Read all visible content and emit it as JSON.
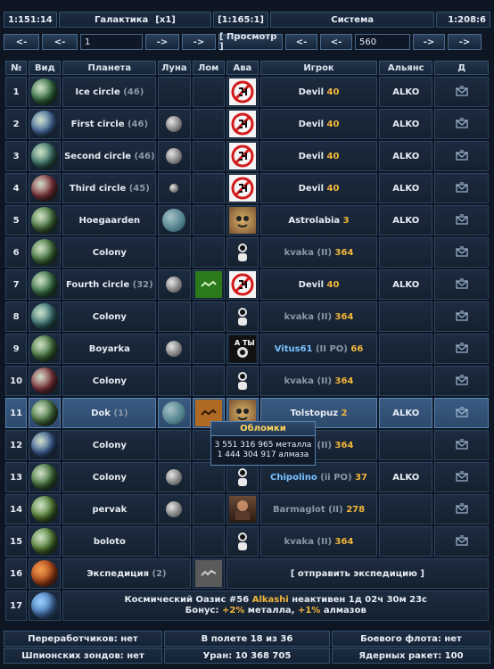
{
  "header": {
    "coords_left": "1:151:14",
    "title": "Галактика",
    "multiplier": "[x1]",
    "coords_mid": "[1:165:1]",
    "system_label": "Система",
    "coords_right": "1:208:6"
  },
  "nav": {
    "galaxy_prev_fast": "<-",
    "galaxy_prev": "<-",
    "galaxy_value": "1",
    "galaxy_next": "->",
    "galaxy_next_fast": "->",
    "view_button": "[ Просмотр ]",
    "system_prev_fast": "<-",
    "system_prev": "<-",
    "system_value": "560",
    "system_next": "->",
    "system_next_fast": "->"
  },
  "columns": [
    "№",
    "Вид",
    "Планета",
    "Луна",
    "Лом",
    "Ава",
    "Игрок",
    "Альянс",
    "Д"
  ],
  "rows": [
    {
      "num": "1",
      "planet": "Ice circle",
      "count": "(46)",
      "planet_color": "#3e7a4a",
      "moon": "",
      "debris": false,
      "ava": "banned",
      "player": "Devil",
      "player_tag": "",
      "level": "40",
      "player_style": "white",
      "alliance": "ALKO"
    },
    {
      "num": "2",
      "planet": "First circle",
      "count": "(46)",
      "planet_color": "#4a6fa8",
      "moon": "normal",
      "debris": false,
      "ava": "banned",
      "player": "Devil",
      "player_tag": "",
      "level": "40",
      "player_style": "white",
      "alliance": "ALKO"
    },
    {
      "num": "3",
      "planet": "Second circle",
      "count": "(46)",
      "planet_color": "#3f7c6e",
      "moon": "normal",
      "debris": false,
      "ava": "banned",
      "player": "Devil",
      "player_tag": "",
      "level": "40",
      "player_style": "white",
      "alliance": "ALKO"
    },
    {
      "num": "4",
      "planet": "Third circle",
      "count": "(45)",
      "planet_color": "#8a3a44",
      "moon": "small",
      "debris": false,
      "ava": "banned",
      "player": "Devil",
      "player_tag": "",
      "level": "40",
      "player_style": "white",
      "alliance": "ALKO"
    },
    {
      "num": "5",
      "planet": "Hoegaarden",
      "count": "",
      "planet_color": "#4f7d45",
      "moon": "big",
      "debris": false,
      "ava": "creature",
      "player": "Astrolabia",
      "player_tag": "",
      "level": "3",
      "player_style": "white",
      "alliance": "ALKO"
    },
    {
      "num": "6",
      "planet": "Colony",
      "count": "",
      "planet_color": "#4a7a42",
      "moon": "",
      "debris": false,
      "ava": "silhouette",
      "player": "kvaka",
      "player_tag": "(II)",
      "level": "364",
      "player_style": "gray",
      "alliance": ""
    },
    {
      "num": "7",
      "planet": "Fourth circle",
      "count": "(32)",
      "planet_color": "#3e7a4a",
      "moon": "normal",
      "debris": true,
      "ava": "banned",
      "player": "Devil",
      "player_tag": "",
      "level": "40",
      "player_style": "white",
      "alliance": "ALKO"
    },
    {
      "num": "8",
      "planet": "Colony",
      "count": "",
      "planet_color": "#3f7c7e",
      "moon": "",
      "debris": false,
      "ava": "silhouette",
      "player": "kvaka",
      "player_tag": "(II)",
      "level": "364",
      "player_style": "gray",
      "alliance": ""
    },
    {
      "num": "9",
      "planet": "Boyarka",
      "count": "",
      "planet_color": "#4a7a42",
      "moon": "normal",
      "debris": false,
      "ava": "sign",
      "player": "Vitus61",
      "player_tag": "(II PO)",
      "level": "66",
      "player_style": "blue",
      "alliance": ""
    },
    {
      "num": "10",
      "planet": "Colony",
      "count": "",
      "planet_color": "#8a3a44",
      "moon": "",
      "debris": false,
      "ava": "silhouette",
      "player": "kvaka",
      "player_tag": "(II)",
      "level": "364",
      "player_style": "gray",
      "alliance": ""
    },
    {
      "num": "11",
      "planet": "Dok",
      "count": "(1)",
      "planet_color": "#4f7d45",
      "moon": "big",
      "debris": true,
      "ava": "creature",
      "player": "Tolstopuz",
      "player_tag": "",
      "level": "2",
      "player_style": "white",
      "alliance": "ALKO"
    },
    {
      "num": "12",
      "planet": "Colony",
      "count": "",
      "planet_color": "#3d5f9a",
      "moon": "",
      "debris": false,
      "ava": "silhouette",
      "player": "kvaka",
      "player_tag": "(II)",
      "level": "364",
      "player_style": "gray",
      "alliance": ""
    },
    {
      "num": "13",
      "planet": "Colony",
      "count": "",
      "planet_color": "#4a7a42",
      "moon": "normal",
      "debris": false,
      "ava": "silhouette",
      "player": "Chipolino",
      "player_tag": "(ii PO)",
      "level": "37",
      "player_style": "blue",
      "alliance": "ALKO"
    },
    {
      "num": "14",
      "planet": "pervak",
      "count": "",
      "planet_color": "#5a8a3a",
      "moon": "normal",
      "debris": false,
      "ava": "photo",
      "player": "Barmaglot",
      "player_tag": "(II)",
      "level": "278",
      "player_style": "gray",
      "alliance": ""
    },
    {
      "num": "15",
      "planet": "boloto",
      "count": "",
      "planet_color": "#5a8a3a",
      "moon": "",
      "debris": false,
      "ava": "silhouette",
      "player": "kvaka",
      "player_tag": "(II)",
      "level": "364",
      "player_style": "gray",
      "alliance": ""
    }
  ],
  "expedition_row": {
    "num": "16",
    "label": "Экспедиция",
    "count": "(2)",
    "action": "[ отправить экспедицию ]"
  },
  "oasis_row": {
    "num": "17",
    "line1_prefix": "Космический Оазис #56",
    "owner": "Alkashi",
    "line1_suffix": "неактивен 1д 02ч 30м 23с",
    "line2_prefix": "Бонус:",
    "bonus_metal": "+2%",
    "metal_word": "металла,",
    "bonus_crystal": "+1%",
    "crystal_word": "алмазов"
  },
  "tooltip": {
    "title": "Обломки",
    "metal_amount": "3 551 316 965",
    "metal_word": "металла",
    "crystal_amount": "1 444 304 917",
    "crystal_word": "алмаза"
  },
  "footer": {
    "recyclers": "Переработчиков: нет",
    "in_flight": "В полете 18 из 36",
    "war_fleet": "Боевого флота: нет",
    "spy_probes": "Шпионских зондов: нет",
    "uranium": "Уран: 10 368 705",
    "nuke_missiles": "Ядерных ракет: 100"
  },
  "colors": {
    "accent_gold": "#f2b63a",
    "player_blue": "#79c1ff",
    "inactive_gray": "#8b98a8",
    "selected_row": "#3a5a82",
    "bonus_green": "#66d866"
  }
}
